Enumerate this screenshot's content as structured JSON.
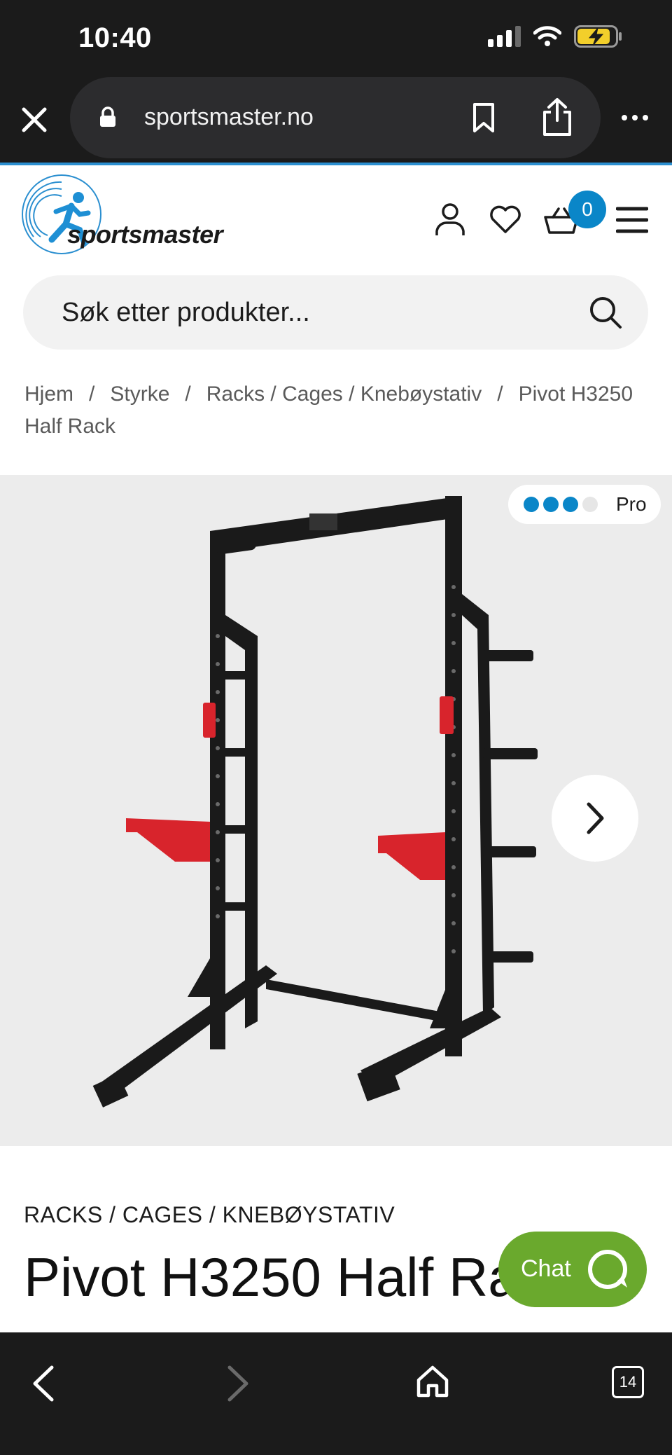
{
  "status_bar": {
    "time": "10:40"
  },
  "browser": {
    "url": "sportsmaster.no"
  },
  "site": {
    "logo_text": "sportsmaster",
    "cart_count": "0"
  },
  "search": {
    "placeholder": "Søk etter produkter..."
  },
  "breadcrumb": {
    "items": [
      "Hjem",
      "Styrke",
      "Racks / Cages / Knebøystativ",
      "Pivot H3250 Half Rack"
    ],
    "separator": "/"
  },
  "product": {
    "level_label": "Pro",
    "level_value": 3,
    "level_max": 4,
    "category": "RACKS / CAGES / KNEBØYSTATIV",
    "title": "Pivot H3250 Half Rack"
  },
  "chat": {
    "label": "Chat"
  },
  "bottom_bar": {
    "tab_count": "14"
  },
  "colors": {
    "accent": "#0a86c8",
    "chat": "#6aa92d",
    "rack_red": "#d8242c",
    "chrome": "#1b1b1b"
  }
}
